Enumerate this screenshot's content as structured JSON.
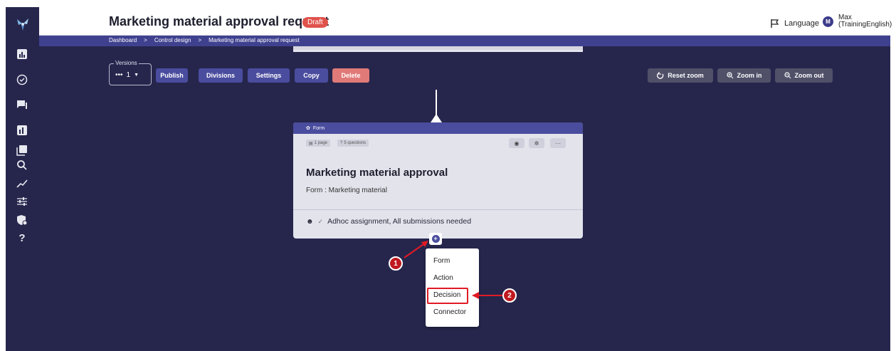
{
  "header": {
    "title": "Marketing material approval request",
    "status_badge": "Draft",
    "language_label": "Language",
    "user_initial": "M",
    "user_name": "Max",
    "user_org": "(TrainingEnglish)"
  },
  "breadcrumb": [
    "Dashboard",
    ">",
    "Control design",
    ">",
    "Marketing material approval request"
  ],
  "sidebar": {
    "icons": [
      "dashboard-icon",
      "check-circle-icon",
      "chat-icon",
      "report-icon",
      "library-icon",
      "search-icon",
      "trend-icon",
      "sliders-icon",
      "shield-settings-icon",
      "help-icon"
    ],
    "help_glyph": "?"
  },
  "toolbar": {
    "versions_legend": "Versions",
    "versions_value": "1",
    "publish": "Publish",
    "divisions": "Divisions",
    "settings": "Settings",
    "copy": "Copy",
    "delete": "Delete",
    "reset_zoom": "Reset zoom",
    "zoom_in": "Zoom in",
    "zoom_out": "Zoom out"
  },
  "card": {
    "type_label": "Form",
    "pages_chip": "1 page",
    "questions_chip": "5 questions",
    "title": "Marketing material approval",
    "subtitle": "Form : Marketing material",
    "assignment": "Adhoc assignment, All submissions needed"
  },
  "add_menu": {
    "items": [
      "Form",
      "Action",
      "Decision",
      "Connector"
    ],
    "highlighted": "Decision"
  },
  "annotations": {
    "step1": "1",
    "step2": "2",
    "color": "#e01b24"
  },
  "colors": {
    "canvas": "#26264d",
    "accent": "#4a4c9e",
    "danger": "#e07a78",
    "badge": "#e0524c"
  }
}
